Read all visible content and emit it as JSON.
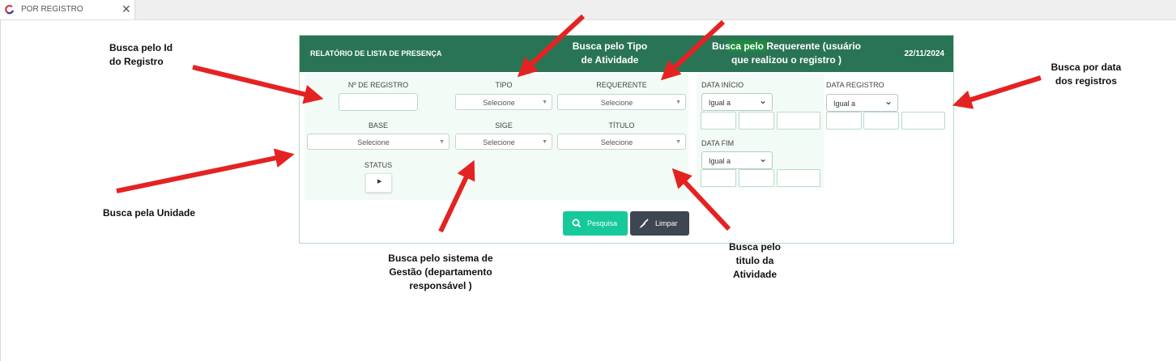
{
  "tab": {
    "title": "POR REGISTRO",
    "close": "✕"
  },
  "panel": {
    "title": "RELATÓRIO DE LISTA DE PRESENÇA",
    "date": "22/11/2024",
    "fields": {
      "registro_label": "Nº DE REGISTRO",
      "tipo_label": "TIPO",
      "requerente_label": "REQUERENTE",
      "base_label": "BASE",
      "sige_label": "SIGE",
      "titulo_label": "TÍTULO",
      "status_label": "STATUS",
      "select_placeholder": "Selecione"
    },
    "dates": {
      "inicio_label": "DATA INÍCIO",
      "fim_label": "DATA FIM",
      "registro_label": "DATA REGISTRO",
      "operator": "Igual a"
    },
    "buttons": {
      "search": "Pesquisa",
      "clear": "Limpar"
    }
  },
  "annotations": {
    "id_line1": "Busca pelo Id",
    "id_line2": "do Registro",
    "tipo_line1": "Busca pelo Tipo",
    "tipo_line2": "de Atividade",
    "requerente_line1": "Busca pelo Requerente (usuário",
    "requerente_line2": "que realizou o registro )",
    "data_line1": "Busca por data",
    "data_line2": "dos registros",
    "unidade": "Busca pela Unidade",
    "sige_line1": "Busca pelo sistema de",
    "sige_line2": "Gestão (departamento",
    "sige_line3": "responsável )",
    "titulo_line1": "Busca pelo",
    "titulo_line2": "titulo da",
    "titulo_line3": "Atividade"
  },
  "colors": {
    "header_green": "#2a7456",
    "search_button": "#16c99a",
    "clear_button": "#3d4651",
    "arrow_red": "#e52222"
  }
}
